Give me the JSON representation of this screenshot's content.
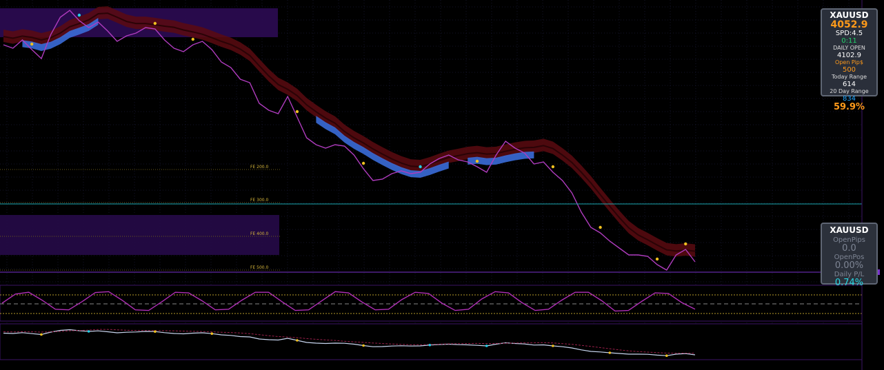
{
  "infobox": {
    "symbol": "XAUUSD",
    "price": "4052.9",
    "spd": "SPD:4.5",
    "timer": "0:11",
    "daily_open_label": "DAILY OPEN",
    "daily_open": "4102.9",
    "open_pips_label": "Open Pip$",
    "open_pips": "500",
    "today_range_label": "Today Range",
    "today_range": "614",
    "day20_range_label": "20 Day Range",
    "day20_range": "834",
    "percent": "59.9%"
  },
  "posbox": {
    "symbol": "XAUUSD",
    "open_pips_label": "OpenPips",
    "open_pips": "0.0",
    "open_pos_label": "OpenPos",
    "open_pos": "0.00%",
    "daily_pl_label": "Daily P/L",
    "daily_pl": "0.74%"
  },
  "colors": {
    "price": "#b03cbf",
    "ribbon": "#5a0a10",
    "ribbon_blue": "#3a6bd8",
    "gold": "#f0c020",
    "cyan": "#22d0e8",
    "accent_orange": "#ff9a1a",
    "accent_green": "#22d36a",
    "pl_cyan": "#26d8e4"
  },
  "chart_data": {
    "type": "line",
    "fe_levels": [
      {
        "label": "FE 200.0"
      },
      {
        "label": "FE 300.0"
      },
      {
        "label": "FE 400.0"
      },
      {
        "label": "FE 500.0"
      }
    ],
    "price_series": [
      4145,
      4140,
      4152,
      4138,
      4125,
      4160,
      4185,
      4195,
      4180,
      4170,
      4178,
      4165,
      4150,
      4158,
      4162,
      4170,
      4168,
      4152,
      4140,
      4135,
      4145,
      4150,
      4138,
      4120,
      4112,
      4095,
      4090,
      4060,
      4050,
      4045,
      4070,
      4040,
      4010,
      4000,
      3995,
      4000,
      3998,
      3985,
      3965,
      3948,
      3950,
      3958,
      3962,
      3958,
      3960,
      3972,
      3980,
      3985,
      3978,
      3975,
      3968,
      3960,
      3985,
      4005,
      3995,
      3988,
      3972,
      3975,
      3960,
      3948,
      3930,
      3902,
      3880,
      3872,
      3860,
      3850,
      3840,
      3840,
      3838,
      3826,
      3818,
      3840,
      3848,
      3830
    ],
    "oscillator": [
      50,
      80,
      86,
      60,
      30,
      28,
      55,
      85,
      88,
      60,
      28,
      26,
      55,
      86,
      84,
      58,
      28,
      30,
      60,
      86,
      86,
      55,
      26,
      28,
      58,
      88,
      84,
      54,
      28,
      30,
      62,
      86,
      82,
      50,
      26,
      30,
      64,
      88,
      84,
      52,
      26,
      30,
      60,
      86,
      86,
      58,
      24,
      26,
      56,
      84,
      82,
      52,
      30
    ]
  }
}
